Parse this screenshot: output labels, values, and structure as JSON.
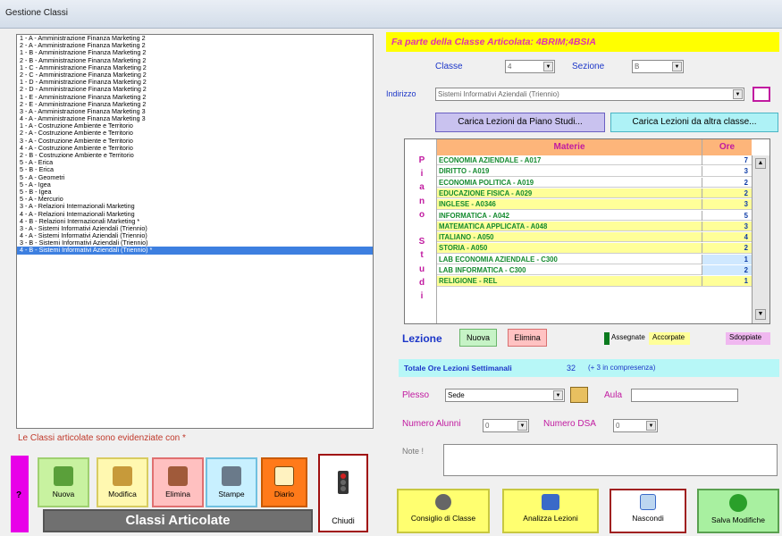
{
  "window": {
    "title": "Gestione Classi"
  },
  "classes": [
    "1 - A - Amministrazione Finanza Marketing 2",
    "2 - A - Amministrazione Finanza Marketing 2",
    "1 - B - Amministrazione Finanza Marketing 2",
    "2 - B - Amministrazione Finanza Marketing 2",
    "1 - C - Amministrazione Finanza Marketing 2",
    "2 - C - Amministrazione Finanza Marketing 2",
    "1 - D - Amministrazione Finanza Marketing 2",
    "2 - D - Amministrazione Finanza Marketing 2",
    "1 - E - Amministrazione Finanza Marketing 2",
    "2 - E - Amministrazione Finanza Marketing 2",
    "3 - A - Amministrazione Finanza Marketing 3",
    "4 - A - Amministrazione Finanza Marketing 3",
    "1 - A - Costruzione Ambiente e Territorio",
    "2 - A - Costruzione Ambiente e Territorio",
    "3 - A - Costruzione Ambiente e Territorio",
    "4 - A - Costruzione Ambiente e Territorio",
    "2 - B - Costruzione Ambiente e Territorio",
    "5 - A - Erica",
    "5 - B - Erica",
    "5 - A - Geometri",
    "5 - A - Igea",
    "5 - B - Igea",
    "5 - A - Mercurio",
    "3 - A - Relazioni Internazionali Marketing",
    "4 - A - Relazioni Internazionali Marketing",
    "4 - B - Relazioni Internazionali Marketing *",
    "3 - A - Sistemi Informativi Aziendali (Triennio)",
    "4 - A - Sistemi Informativi Aziendali (Triennio)",
    "3 - B - Sistemi Informativi Aziendali (Triennio)",
    "4 - B - Sistemi Informativi Aziendali (Triennio) *"
  ],
  "selected_index": 29,
  "legend_note": "Le Classi articolate sono evidenziate con *",
  "help_label": "?",
  "left_buttons": {
    "nuova": "Nuova",
    "modifica": "Modifica",
    "elimina": "Elimina",
    "stampe": "Stampe",
    "diario": "Diario",
    "classi_articolate": "Classi Articolate",
    "chiudi": "Chiudi"
  },
  "articolata": "Fa parte della Classe Articolata: 4BRIM;4BSIA",
  "form": {
    "classe_label": "Classe",
    "classe_value": "4",
    "sezione_label": "Sezione",
    "sezione_value": "B",
    "indirizzo_label": "Indirizzo",
    "indirizzo_value": "Sistemi Informativi Aziendali (Triennio)",
    "carica_piano": "Carica Lezioni da Piano Studi...",
    "carica_altra": "Carica Lezioni da altra classe..."
  },
  "grid": {
    "vertical_label": [
      "P",
      "i",
      "a",
      "n",
      "o",
      "",
      "S",
      "t",
      "u",
      "d",
      "i"
    ],
    "header_materie": "Materie",
    "header_ore": "Ore",
    "rows": [
      {
        "materia": "ECONOMIA AZIENDALE - A017",
        "ore": "7",
        "hl": false
      },
      {
        "materia": "DIRITTO - A019",
        "ore": "3",
        "hl": false
      },
      {
        "materia": "ECONOMIA POLITICA - A019",
        "ore": "2",
        "hl": false
      },
      {
        "materia": "EDUCAZIONE FISICA - A029",
        "ore": "2",
        "hl": true
      },
      {
        "materia": "INGLESE - A0346",
        "ore": "3",
        "hl": true
      },
      {
        "materia": "INFORMATICA - A042",
        "ore": "5",
        "hl": false
      },
      {
        "materia": "MATEMATICA APPLICATA - A048",
        "ore": "3",
        "hl": true
      },
      {
        "materia": "ITALIANO - A050",
        "ore": "4",
        "hl": true
      },
      {
        "materia": "STORIA - A050",
        "ore": "2",
        "hl": true
      },
      {
        "materia": "LAB ECONOMIA AZIENDALE - C300",
        "ore": "1",
        "hl": false
      },
      {
        "materia": "LAB INFORMATICA - C300",
        "ore": "2",
        "hl": false
      },
      {
        "materia": "RELIGIONE - REL",
        "ore": "1",
        "hl": true
      }
    ]
  },
  "lezione": {
    "label": "Lezione",
    "nuova": "Nuova",
    "elimina": "Elimina",
    "legend_assegnate": "Assegnate",
    "legend_accorpate": "Accorpate",
    "legend_sdoppiate": "Sdoppiate",
    "colors": {
      "assegnate": "#0a7a1e",
      "accorpate": "#ffff99",
      "sdoppiate": "#f0b8f0"
    }
  },
  "totale": {
    "label": "Totale Ore Lezioni Settimanali",
    "value": "32",
    "note": "(+ 3 in compresenza)"
  },
  "plesso": {
    "label": "Plesso",
    "value": "Sede",
    "aula_label": "Aula",
    "aula_value": ""
  },
  "alunni": {
    "label": "Numero Alunni",
    "value": "0",
    "dsa_label": "Numero DSA",
    "dsa_value": "0"
  },
  "note": {
    "label": "Note !",
    "value": ""
  },
  "bottom_buttons": {
    "consiglio": "Consiglio di Classe",
    "analizza": "Analizza Lezioni",
    "nascondi": "Nascondi",
    "salva": "Salva Modifiche"
  }
}
